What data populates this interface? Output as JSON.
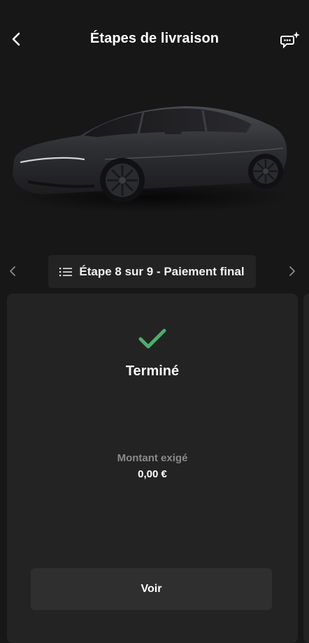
{
  "header": {
    "title": "Étapes de livraison",
    "back_icon": "chevron-left-icon",
    "assistant_icon": "chat-sparkle-icon"
  },
  "vehicle": {
    "image": "car-image",
    "color": "#2e2f33"
  },
  "step_nav": {
    "label": "Étape 8 sur 9 - Paiement final",
    "prev_icon": "chevron-left-icon",
    "next_icon": "chevron-right-icon",
    "list_icon": "list-icon"
  },
  "card": {
    "status_icon": "check-icon",
    "status_color": "#4caf68",
    "status": "Terminé",
    "amount_label": "Montant exigé",
    "amount_value": "0,00 €",
    "button_label": "Voir"
  }
}
